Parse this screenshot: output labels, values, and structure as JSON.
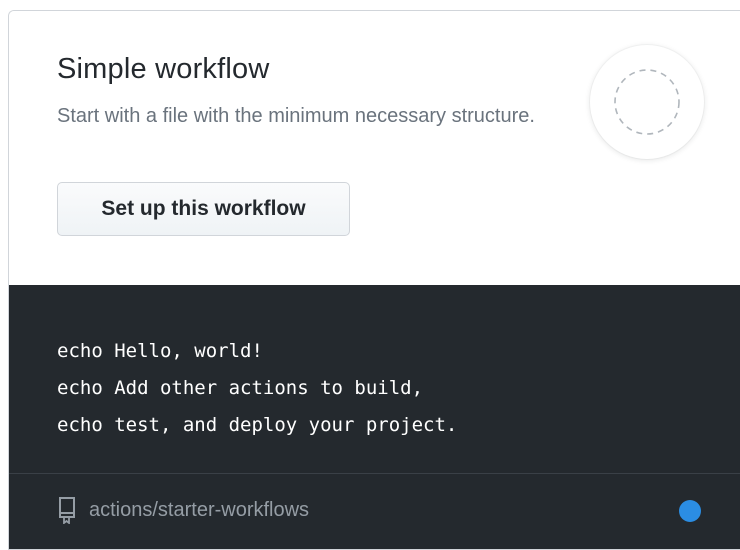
{
  "card": {
    "title": "Simple workflow",
    "description": "Start with a file with the minimum necessary structure.",
    "setup_button_label": "Set up this workflow",
    "logo_icon": "dashed-circle-icon",
    "code_lines": "echo Hello, world!\necho Add other actions to build,\necho test, and deploy your project.",
    "footer": {
      "repo_icon": "repo-icon",
      "repo_name": "actions/starter-workflows",
      "language_dot_color": "#2b8de3"
    }
  },
  "colors": {
    "code_background": "#24292e",
    "title_text": "#24292e",
    "muted_text": "#6a737d"
  }
}
